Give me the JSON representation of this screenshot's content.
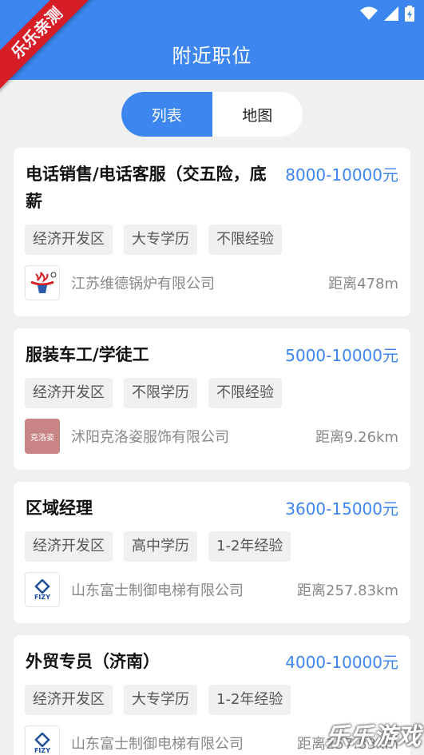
{
  "header": {
    "title": "附近职位",
    "ribbon": "乐乐亲测"
  },
  "segments": {
    "list": "列表",
    "map": "地图"
  },
  "jobs": [
    {
      "title": "电话销售/电话客服（交五险，底薪",
      "salary": "8000-10000元",
      "tags": [
        "经济开发区",
        "大专学历",
        "不限经验"
      ],
      "company": "江苏维德锅炉有限公司",
      "distance": "距离478m",
      "logo_text": ""
    },
    {
      "title": "服装车工/学徒工",
      "salary": "5000-10000元",
      "tags": [
        "经济开发区",
        "不限学历",
        "不限经验"
      ],
      "company": "沭阳克洛姿服饰有限公司",
      "distance": "距离9.26km",
      "logo_text": "克洛姿"
    },
    {
      "title": "区域经理",
      "salary": "3600-15000元",
      "tags": [
        "经济开发区",
        "高中学历",
        "1-2年经验"
      ],
      "company": "山东富士制御电梯有限公司",
      "distance": "距离257.83km",
      "logo_text": "FIZY"
    },
    {
      "title": "外贸专员（济南）",
      "salary": "4000-10000元",
      "tags": [
        "经济开发区",
        "大专学历",
        "1-2年经验"
      ],
      "company": "山东富士制御电梯有限公司",
      "distance": "距离257.83km",
      "logo_text": "FIZY"
    }
  ],
  "watermark": "乐乐游戏",
  "colors": {
    "primary": "#3d86f0",
    "ribbon": "#d71e26"
  }
}
